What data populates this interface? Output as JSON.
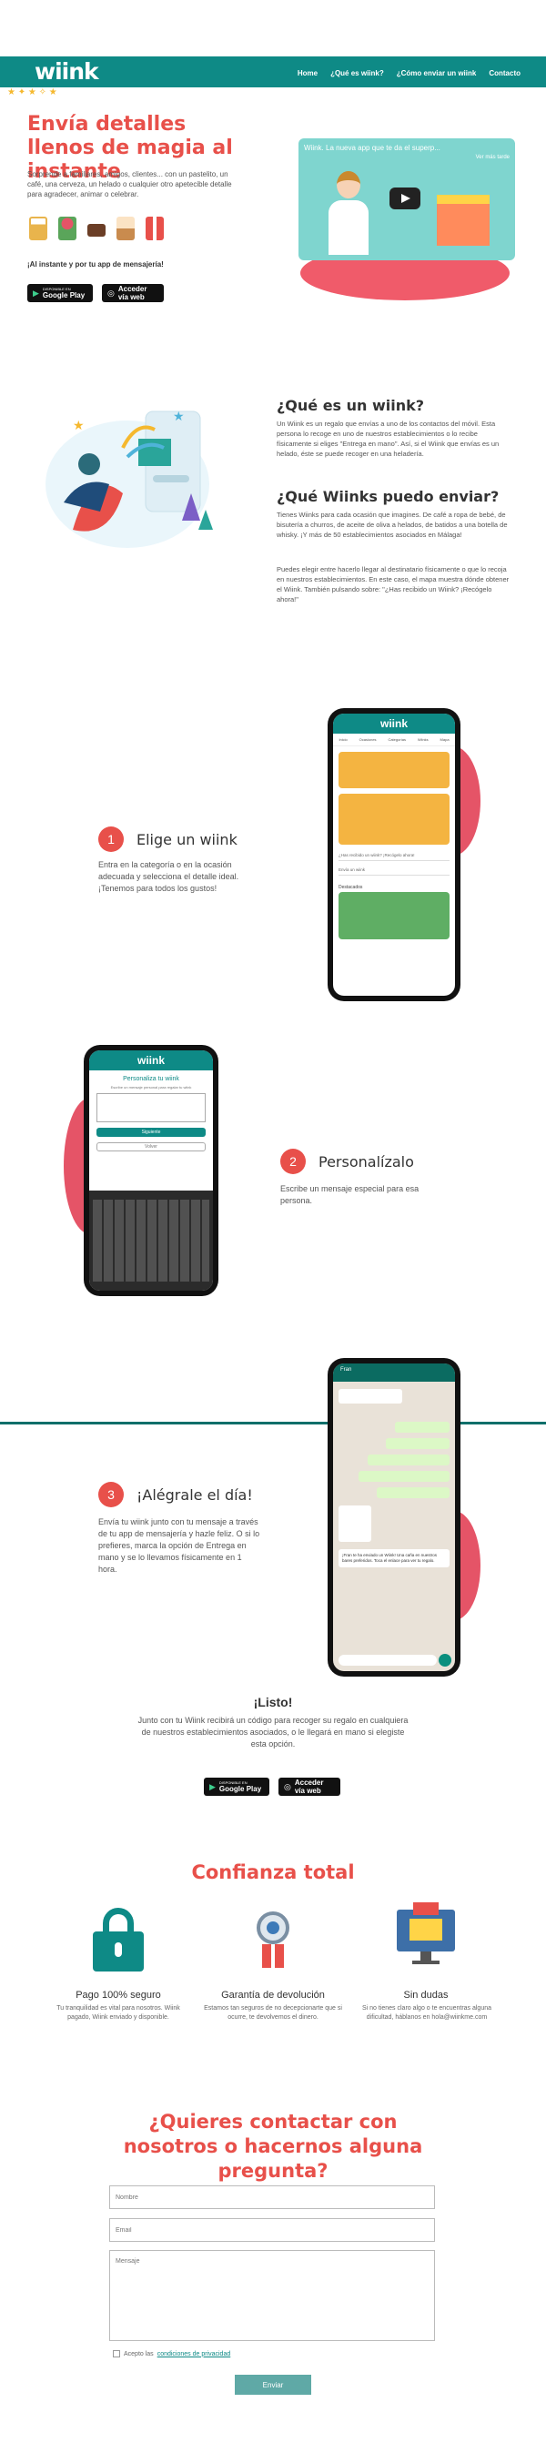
{
  "header": {
    "logo": "wiink",
    "nav": [
      "Home",
      "¿Qué es wiink?",
      "¿Cómo enviar un wiink",
      "Contacto"
    ]
  },
  "hero": {
    "title": "Envía detalles llenos de magia al instante",
    "text": "Sorprende a familiares, amigos, clientes... con un pastelito, un café, una cerveza, un helado o cualquier otro apetecible detalle para agradecer, animar o celebrar.",
    "slogan": "¡Al instante y por tu app de mensajería!",
    "video_title": "Wiink. La nueva app que te da el superp...",
    "video_later": "Ver más tarde",
    "gp_small": "DISPONIBLE EN",
    "gp_large": "Google Play",
    "web_small": "Acceder",
    "web_large": "vía web"
  },
  "what": {
    "title1": "¿Qué es un wiink?",
    "text1": "Un Wiink es un regalo que envías a uno de los contactos del móvil. Esta persona lo recoge en uno de nuestros establecimientos o lo recibe físicamente si eliges \"Entrega en mano\". Así, si el Wiink que envías es un helado, éste se puede recoger en una heladería.",
    "title2": "¿Qué Wiinks puedo enviar?",
    "text2": "Tienes Wiinks para cada ocasión que imagines. De café a ropa de bebé, de bisutería a churros, de aceite de oliva a helados, de batidos a una botella de whisky. ¡Y más de 50 establecimientos asociados en Málaga!",
    "text3": "Puedes elegir entre hacerlo llegar al destinatario físicamente o que lo recoja en nuestros establecimientos. En este caso, el mapa muestra dónde obtener el Wiink. También pulsando sobre: \"¿Has recibido un Wiink? ¡Recógelo ahora!\""
  },
  "steps": [
    {
      "num": "1",
      "title": "Elige un wiink",
      "text": "Entra en la categoría o en la ocasión adecuada y selecciona el detalle ideal. ¡Tenemos para todos los gustos!"
    },
    {
      "num": "2",
      "title": "Personalízalo",
      "text": "Escribe un mensaje especial para esa persona."
    },
    {
      "num": "3",
      "title": "¡Alégrale el día!",
      "text": "Envía tu wiink junto con tu mensaje a través de tu app de mensajería y hazle feliz. O si lo prefieres, marca la opción de Entrega en mano y se lo llevamos físicamente en 1 hora."
    }
  ],
  "phone1": {
    "brand": "wiink",
    "tabs": [
      "Inicio",
      "Ocasiones",
      "Categorías",
      "Wiinks",
      "Mapa"
    ],
    "search1": "¿Has recibido un wiink? ¡Recógelo ahora!",
    "search2": "Envía un wiink",
    "featured": "Destacados"
  },
  "phone2": {
    "brand": "wiink",
    "title": "Personaliza tu wiink",
    "subtitle": "Escribe un mensaje personal para regalar tu wiink",
    "next": "Siguiente",
    "back": "Volver"
  },
  "phone3": {
    "contact": "Fran",
    "msg_bottom": "¡Fran te ha enviado un Wiink! Una caña en nuestros bares preferidos. Toca el enlace para ver tu regalo."
  },
  "listo": {
    "title": "¡Listo!",
    "text": "Junto con tu Wiink recibirá un código para recoger su regalo en cualquiera de nuestros establecimientos asociados, o le llegará en mano si elegiste esta opción."
  },
  "trust": {
    "title": "Confianza total",
    "cards": [
      {
        "title": "Pago 100% seguro",
        "text": "Tu tranquilidad es vital para nosotros. Wiink pagado, Wiink enviado y disponible."
      },
      {
        "title": "Garantía de devolución",
        "text": "Estamos tan seguros de no decepcionarte que si ocurre, te devolvemos el dinero."
      },
      {
        "title": "Sin dudas",
        "text": "Si no tienes claro algo o te encuentras alguna dificultad, háblanos en hola@wiinkme.com"
      }
    ]
  },
  "contact": {
    "title": "¿Quieres contactar con nosotros o hacernos alguna pregunta?",
    "name": "Nombre",
    "email": "Email",
    "message": "Mensaje",
    "privacy_prefix": "Acepto las",
    "privacy_link": "condiciones de privacidad",
    "send": "Enviar"
  },
  "colors": {
    "teal": "#0e8a86",
    "coral": "#e8504a",
    "pink": "#e55467"
  }
}
